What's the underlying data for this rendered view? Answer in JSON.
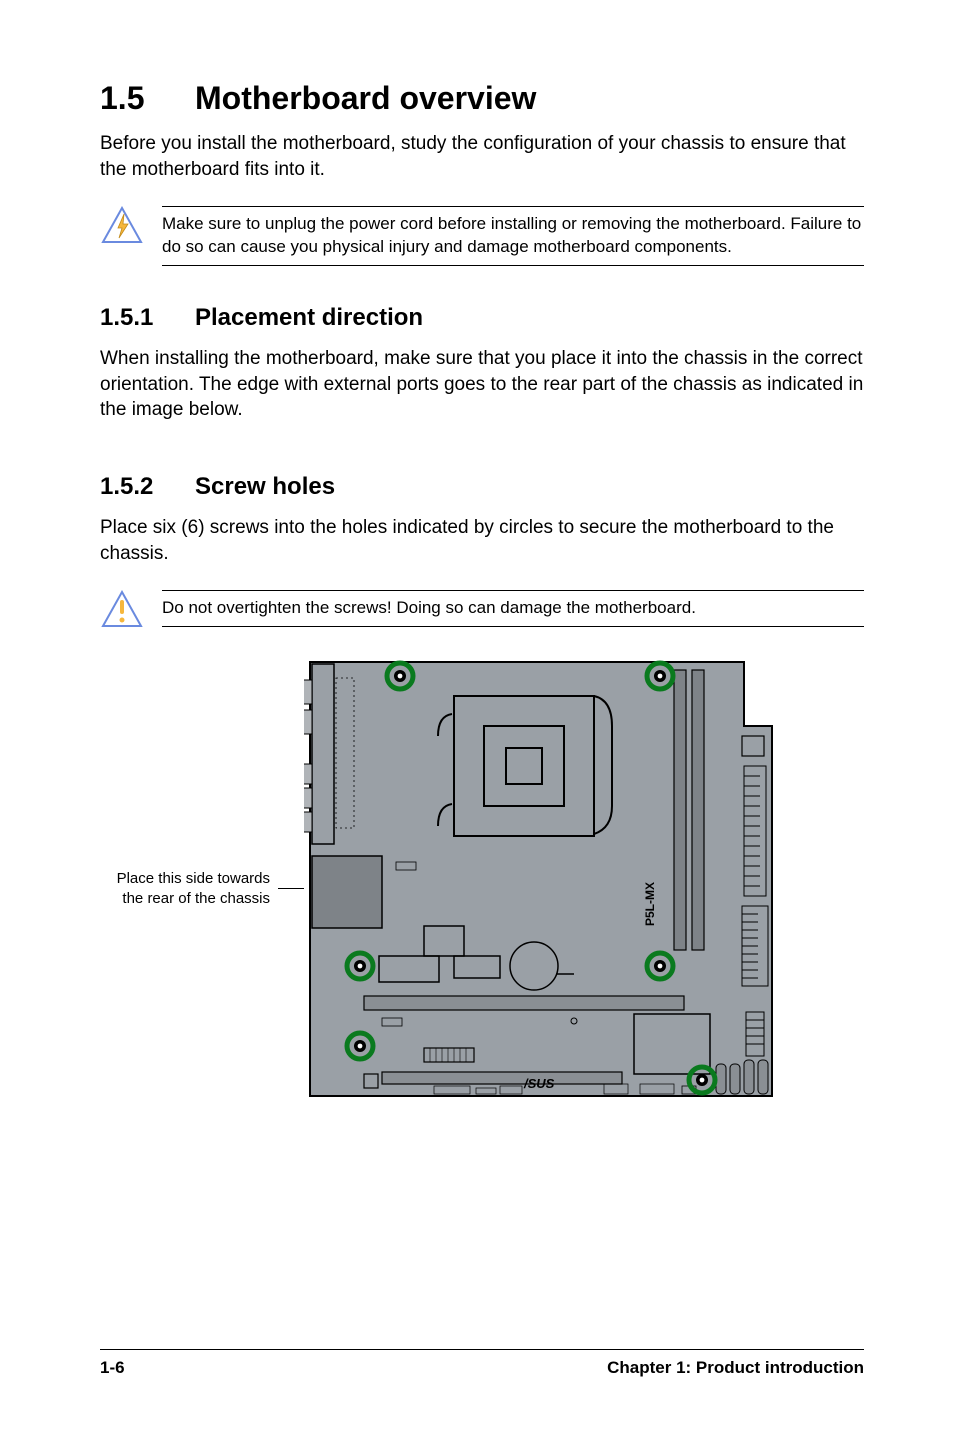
{
  "heading": {
    "num": "1.5",
    "title": "Motherboard overview"
  },
  "intro": "Before you install the motherboard, study the configuration of your chassis to ensure that the motherboard fits into it.",
  "warning1": "Make sure to unplug the power cord before installing or removing the motherboard. Failure to do so can cause you physical injury and damage motherboard components.",
  "sub1": {
    "num": "1.5.1",
    "title": "Placement direction"
  },
  "sub1_body": "When installing the motherboard, make sure that you place it into the chassis in the correct orientation. The edge with external ports goes to the rear part of the chassis as indicated in the image below.",
  "sub2": {
    "num": "1.5.2",
    "title": "Screw holes"
  },
  "sub2_body": "Place six (6) screws into the holes indicated by circles to secure the motherboard to the chassis.",
  "warning2": "Do not overtighten the screws! Doing so can damage the motherboard.",
  "figure": {
    "label_line1": "Place this side towards",
    "label_line2": "the rear of the chassis",
    "board_model": "P5L-MX",
    "brand": "/SUS",
    "screw_count": 6
  },
  "footer": {
    "page": "1-6",
    "chapter": "Chapter 1: Product introduction"
  }
}
